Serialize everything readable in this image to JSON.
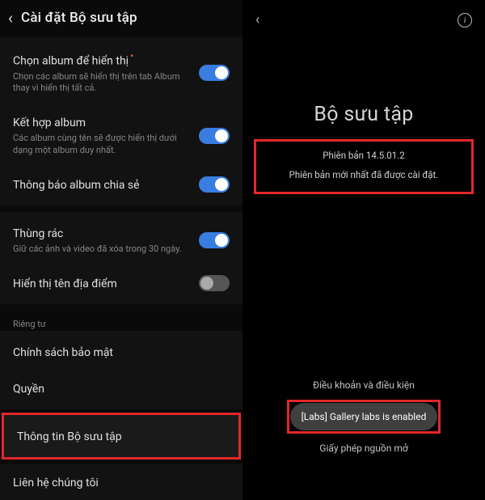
{
  "left": {
    "header": {
      "title": "Cài đặt Bộ sưu tập"
    },
    "items": {
      "chooseAlbum": {
        "title": "Chọn album để hiển thị",
        "desc": "Chọn các album sẽ hiển thị trên tab Album thay vì hiển thị tất cả."
      },
      "mergeAlbum": {
        "title": "Kết hợp album",
        "desc": "Các album cùng tên sẽ được hiển thị dưới dạng một album duy nhất."
      },
      "sharedAlbumNotify": {
        "title": "Thông báo album chia sẻ"
      },
      "trash": {
        "title": "Thùng rác",
        "desc": "Giữ các ảnh và video đã xóa trong 30 ngày."
      },
      "showLocation": {
        "title": "Hiển thị tên địa điểm"
      },
      "privacySection": "Riêng tư",
      "privacyPolicy": {
        "title": "Chính sách bảo mật"
      },
      "permissions": {
        "title": "Quyền"
      },
      "aboutGallery": {
        "title": "Thông tin Bộ sưu tập"
      },
      "contactUs": {
        "title": "Liên hệ chúng tôi"
      }
    }
  },
  "right": {
    "title": "Bộ sưu tập",
    "version": "Phiên bản 14.5.01.2",
    "status": "Phiên bản mới nhất đã được cài đặt.",
    "links": {
      "terms": "Điều khoản và điều kiện",
      "openSource": "Giấy phép nguồn mở"
    },
    "toast": "[Labs] Gallery labs is enabled"
  }
}
